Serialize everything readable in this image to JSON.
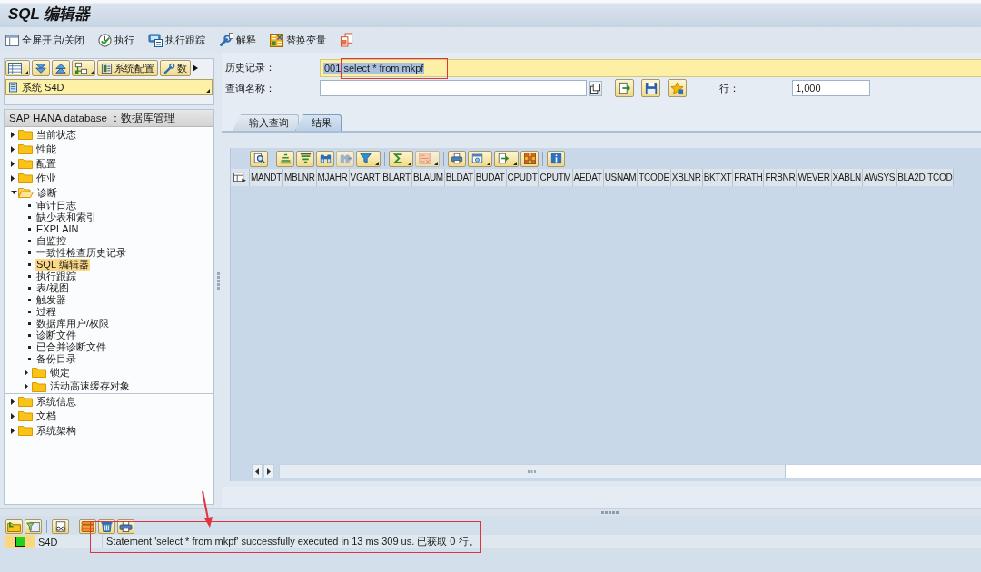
{
  "window": {
    "title": "SQL 编辑器"
  },
  "toolbar": [
    "全屏开启/关闭",
    "执行",
    "执行跟踪",
    "解释",
    "替换变量"
  ],
  "navigator": {
    "toolbar_buttons": [
      "系统配置",
      "数"
    ],
    "system": "系统 S4D",
    "tree_title": "SAP HANA database ：数据库管理",
    "tree": [
      {
        "label": "当前状态",
        "kind": "folder",
        "expanded": false,
        "selected": false
      },
      {
        "label": "性能",
        "kind": "folder",
        "expanded": false,
        "selected": false
      },
      {
        "label": "配置",
        "kind": "folder",
        "expanded": false,
        "selected": false
      },
      {
        "label": "作业",
        "kind": "folder",
        "expanded": false,
        "selected": false
      },
      {
        "label": "诊断",
        "kind": "folder",
        "expanded": true,
        "selected": false,
        "children": [
          {
            "label": "审计日志",
            "kind": "leaf",
            "selected": false
          },
          {
            "label": "缺少表和索引",
            "kind": "leaf",
            "selected": false
          },
          {
            "label": "EXPLAIN",
            "kind": "leaf",
            "selected": false
          },
          {
            "label": "自监控",
            "kind": "leaf",
            "selected": false
          },
          {
            "label": "一致性检查历史记录",
            "kind": "leaf",
            "selected": false
          },
          {
            "label": "SQL 编辑器",
            "kind": "leaf",
            "selected": true
          },
          {
            "label": "执行跟踪",
            "kind": "leaf",
            "selected": false
          },
          {
            "label": "表/视图",
            "kind": "leaf",
            "selected": false
          },
          {
            "label": "触发器",
            "kind": "leaf",
            "selected": false
          },
          {
            "label": "过程",
            "kind": "leaf",
            "selected": false
          },
          {
            "label": "数据库用户/权限",
            "kind": "leaf",
            "selected": false
          },
          {
            "label": "诊断文件",
            "kind": "leaf",
            "selected": false
          },
          {
            "label": "已合并诊断文件",
            "kind": "leaf",
            "selected": false
          },
          {
            "label": "备份目录",
            "kind": "leaf",
            "selected": false
          },
          {
            "label": "锁定",
            "kind": "folder",
            "expanded": false,
            "selected": false
          },
          {
            "label": "活动高速缓存对象",
            "kind": "folder",
            "expanded": false,
            "selected": false
          }
        ]
      },
      {
        "label": "系统信息",
        "kind": "folder",
        "expanded": false,
        "selected": false
      },
      {
        "label": "文档",
        "kind": "folder",
        "expanded": false,
        "selected": false
      },
      {
        "label": "系统架构",
        "kind": "folder",
        "expanded": false,
        "selected": false
      }
    ]
  },
  "query": {
    "history": {
      "label": "历史记录：",
      "value": "001 select * from mkpf",
      "text_selected": true
    },
    "name": {
      "label": "查询名称："
    },
    "rows": {
      "label": "行：",
      "value": "1,000"
    }
  },
  "tabs": [
    {
      "label": "输入查询",
      "selected": false
    },
    {
      "label": "结果",
      "selected": true
    }
  ],
  "result": {
    "toolbar": [
      {
        "disabled": false
      },
      {
        "disabled": false
      },
      {
        "disabled": false
      },
      {
        "disabled": false
      },
      {
        "disabled": true
      },
      {
        "disabled": false
      },
      {
        "disabled": false
      },
      {
        "disabled": true
      },
      {
        "disabled": false
      },
      {
        "disabled": false
      },
      {
        "disabled": false
      },
      {
        "disabled": false
      },
      {
        "disabled": false
      }
    ],
    "columns": [
      "MANDT",
      "MBLNR",
      "MJAHR",
      "VGART",
      "BLART",
      "BLAUM",
      "BLDAT",
      "BUDAT",
      "CPUDT",
      "CPUTM",
      "AEDAT",
      "USNAM",
      "TCODE",
      "XBLNR",
      "BKTXT",
      "FRATH",
      "FRBNR",
      "WEVER",
      "XABLN",
      "AWSYS",
      "BLA2D",
      "TCOD"
    ]
  },
  "messages": [
    {
      "kind": "success",
      "system": "S4D",
      "text": "Statement 'select * from mkpf' successfully executed in 13 ms 309 us. 已获取 0 行。"
    }
  ]
}
